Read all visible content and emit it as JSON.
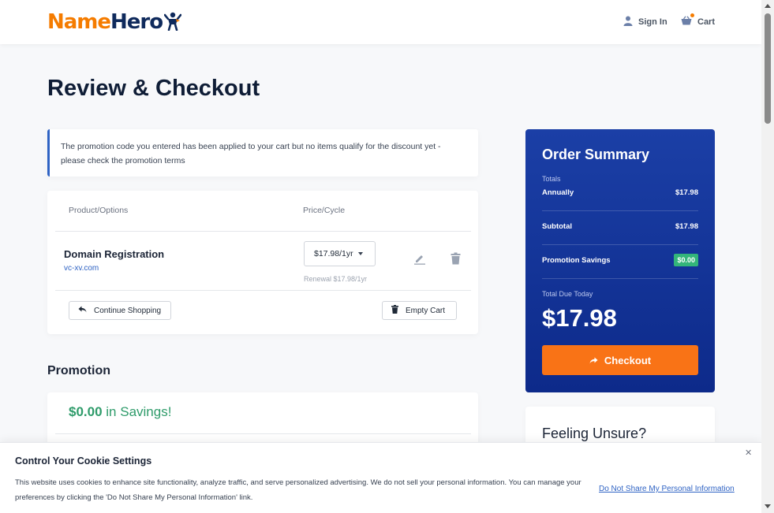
{
  "brand": {
    "name_part1": "Name",
    "name_part2": "Hero",
    "accent_color": "#f57c00",
    "dark_color": "#0f2a5c"
  },
  "header": {
    "signin_label": "Sign In",
    "cart_label": "Cart",
    "signin_icon": "user-icon",
    "cart_icon": "basket-icon"
  },
  "page": {
    "title": "Review & Checkout"
  },
  "alert": {
    "message": "The promotion code you entered has been applied to your cart but no items qualify for the discount yet - please check the promotion terms"
  },
  "cart": {
    "columns": [
      "Product/Options",
      "Price/Cycle"
    ],
    "items": [
      {
        "name": "Domain Registration",
        "domain": "vc-xv.com",
        "cycle": "$17.98/1yr",
        "renewal": "Renewal $17.98/1yr"
      }
    ],
    "continue_label": "Continue Shopping",
    "empty_label": "Empty Cart"
  },
  "promotion": {
    "title": "Promotion",
    "savings_amount": "$0.00",
    "savings_suffix": "in Savings!",
    "savings_color": "#2e9b6a"
  },
  "summary": {
    "title": "Order Summary",
    "totals_label": "Totals",
    "annually_label": "Annually",
    "annually_value": "$17.98",
    "subtotal_label": "Subtotal",
    "subtotal_value": "$17.98",
    "promo_label": "Promotion Savings",
    "promo_value": "$0.00",
    "due_label": "Total Due Today",
    "due_value": "$17.98",
    "checkout_label": "Checkout",
    "bg_color": "#1b3fa6",
    "button_color": "#f97316"
  },
  "unsure": {
    "title": "Feeling Unsure?"
  },
  "cookie": {
    "title": "Control Your Cookie Settings",
    "text": "This website uses cookies to enhance site functionality, analyze traffic, and serve personalized advertising. We do not sell your personal information. You can manage your preferences by clicking the 'Do Not Share My Personal Information' link.",
    "link_label": "Do Not Share My Personal Information",
    "close_label": "✕"
  }
}
